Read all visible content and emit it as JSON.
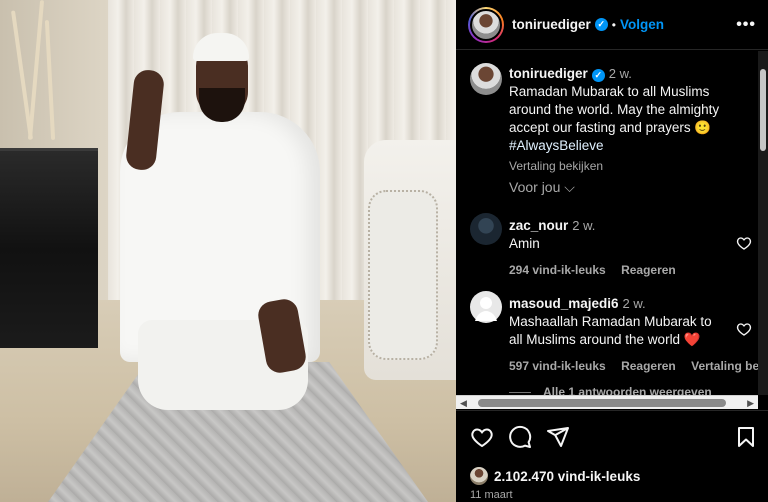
{
  "header": {
    "username": "toniruediger",
    "separator": "•",
    "follow_label": "Volgen",
    "more_label": "•••"
  },
  "caption": {
    "username": "toniruediger",
    "time": "2 w.",
    "text": "Ramadan Mubarak to all Muslims around the world. May the almighty accept our fasting and prayers 🙂",
    "hashtag": "#AlwaysBelieve",
    "translate": "Vertaling bekijken"
  },
  "sort_label": "Voor jou ⌵",
  "comments": [
    {
      "username": "zac_nour",
      "time": "2 w.",
      "text": "Amin",
      "likes": "294 vind-ik-leuks",
      "reply": "Reageren"
    },
    {
      "username": "masoud_majedi6",
      "time": "2 w.",
      "text": "Mashaallah Ramadan Mubarak to all Muslims around the world ❤️",
      "likes": "597 vind-ik-leuks",
      "reply": "Reageren",
      "translate": "Vertaling bekijken"
    }
  ],
  "replies_label": "Alle 1 antwoorden weergeven",
  "post": {
    "likes": "2.102.470 vind-ik-leuks",
    "date": "11 maart"
  },
  "colors": {
    "accent": "#0095f6",
    "background": "#000000",
    "secondary_text": "#a8a8a8",
    "heart_red": "#ed4956"
  },
  "icons": [
    "heart-icon",
    "comment-icon",
    "share-icon",
    "bookmark-icon",
    "verified-icon",
    "more-icon"
  ]
}
